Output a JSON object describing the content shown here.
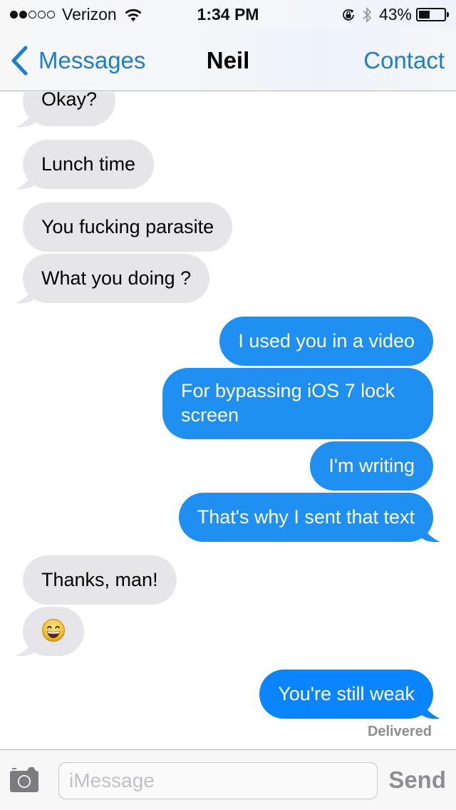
{
  "status_bar": {
    "signal_bars_filled": 2,
    "signal_bars_total": 5,
    "carrier": "Verizon",
    "wifi_icon": "wifi-icon",
    "time": "1:34 PM",
    "rotation_lock_icon": "rotation-lock-icon",
    "bluetooth_icon": "bluetooth-icon",
    "battery_percent_label": "43%",
    "battery_level": 0.43
  },
  "nav": {
    "back_label": "Messages",
    "title": "Neil",
    "right_label": "Contact"
  },
  "colors": {
    "accent": "#1b7ed3",
    "incoming_bubble": "#e5e5ea",
    "outgoing_bubble": "#1f8ff1",
    "outgoing_bubble_latest": "#0a84ff"
  },
  "messages": [
    {
      "direction": "incoming",
      "text": "Okay?"
    },
    {
      "direction": "incoming",
      "text": "Lunch time"
    },
    {
      "direction": "incoming",
      "text": "You fucking parasite"
    },
    {
      "direction": "incoming",
      "text": "What you doing ?"
    },
    {
      "direction": "outgoing",
      "text": "I used you in a video"
    },
    {
      "direction": "outgoing",
      "text": "For bypassing iOS 7 lock screen"
    },
    {
      "direction": "outgoing",
      "text": "I'm writing"
    },
    {
      "direction": "outgoing",
      "text": "That's why I sent that text"
    },
    {
      "direction": "incoming",
      "text": "Thanks, man!"
    },
    {
      "direction": "incoming",
      "text": "😄",
      "icon": "grinning-face-emoji"
    },
    {
      "direction": "outgoing",
      "text": "You're still weak"
    }
  ],
  "delivery_status": "Delivered",
  "composer": {
    "camera_icon": "camera-icon",
    "placeholder": "iMessage",
    "value": "",
    "send_label": "Send"
  }
}
